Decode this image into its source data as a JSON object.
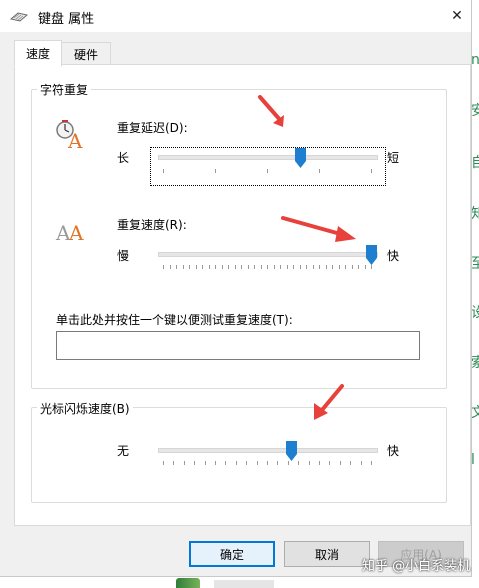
{
  "window": {
    "title": "键盘 属性",
    "close_glyph": "✕"
  },
  "tabs": [
    {
      "label": "速度",
      "active": true
    },
    {
      "label": "硬件",
      "active": false
    }
  ],
  "repeat_group": {
    "legend": "字符重复",
    "delay": {
      "label": "重复延迟(D):",
      "left": "长",
      "right": "短",
      "value_fraction": 0.66,
      "ticks": 4
    },
    "rate": {
      "label": "重复速度(R):",
      "left": "慢",
      "right": "快",
      "value_fraction": 1.0,
      "ticks": 32
    },
    "test_label": "单击此处并按住一个键以便测试重复速度(T):",
    "test_value": ""
  },
  "cursor_group": {
    "legend": "光标闪烁速度(B)",
    "blink": {
      "left": "无",
      "right": "快",
      "value_fraction": 0.62,
      "ticks": 20
    }
  },
  "buttons": {
    "ok": "确定",
    "cancel": "取消",
    "apply": "应用(A)"
  },
  "background": {
    "side_chars": [
      "n",
      "安",
      "自",
      "知",
      "至",
      "设",
      "索",
      "文",
      "l"
    ],
    "watermark": "知乎 @小白系装机"
  },
  "colors": {
    "accent": "#0078d7",
    "thumb": "#1e7fd0",
    "arrow": "#e8403b"
  }
}
